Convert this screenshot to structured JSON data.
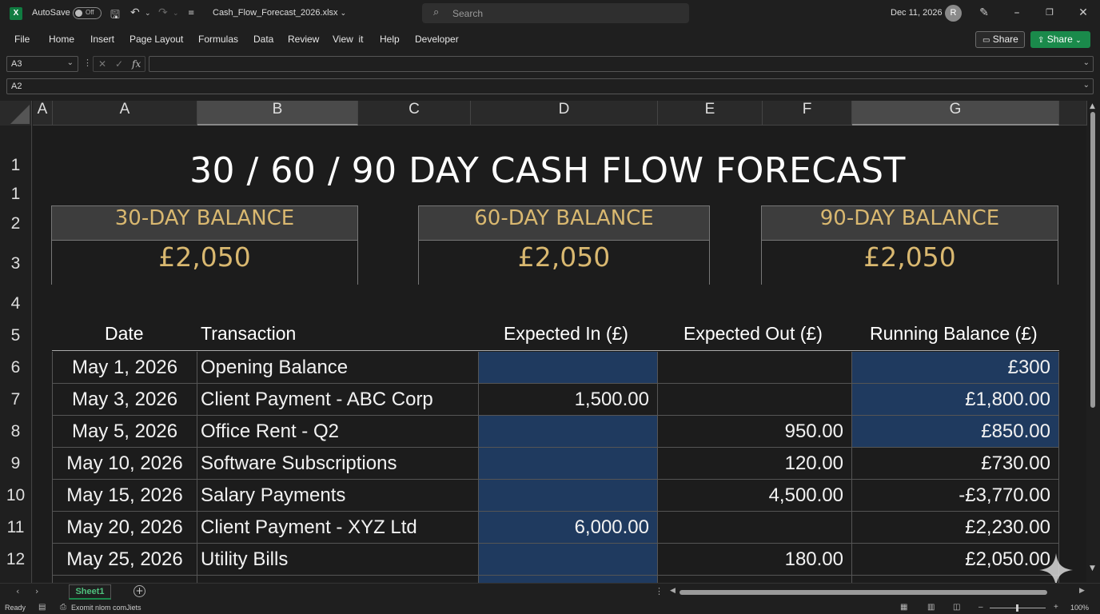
{
  "titlebar": {
    "app_icon": "excel-logo",
    "app_letter": "X",
    "autosave_label": "AutoSave",
    "autosave_state": "Off",
    "filename": "Cash_Flow_Forecast_2026.xlsx",
    "search_placeholder": "Search",
    "date": "Dec 11, 2026",
    "avatar_initial": "R"
  },
  "menu": {
    "items": [
      "File",
      "Home",
      "Insert",
      "Page Layout",
      "Formulas",
      "Data",
      "Review",
      "View  it",
      "Help",
      "Developer"
    ],
    "share_label": "Share",
    "share_green_label": "Share"
  },
  "formula_bar": {
    "name_box": "A3",
    "fx_label": "fx",
    "formula": "",
    "secondary_name_box": "A2"
  },
  "grid": {
    "corner_col_label": "A",
    "columns": [
      "A",
      "B",
      "C",
      "D",
      "E",
      "F",
      "G"
    ],
    "selected_columns": [
      "B",
      "G"
    ],
    "rows": [
      "1",
      "1",
      "2",
      "3",
      "4",
      "5",
      "6",
      "7",
      "8",
      "9",
      "10",
      "11",
      "12"
    ]
  },
  "sheet": {
    "title": "30 / 60 / 90 DAY CASH FLOW FORECAST",
    "balances": [
      {
        "label": "30-DAY BALANCE",
        "value": "£2,050"
      },
      {
        "label": "60-DAY BALANCE",
        "value": "£2,050"
      },
      {
        "label": "90-DAY BALANCE",
        "value": "£2,050"
      }
    ],
    "table_headers": {
      "date": "Date",
      "transaction": "Transaction",
      "expected_in": "Expected In (£)",
      "expected_out": "Expected Out (£)",
      "running_balance": "Running Balance (£)"
    },
    "rows": [
      {
        "date": "May 1, 2026",
        "transaction": "Opening Balance",
        "in": "",
        "out": "",
        "balance": "£300"
      },
      {
        "date": "May 3, 2026",
        "transaction": "Client Payment - ABC Corp",
        "in": "1,500.00",
        "out": "",
        "balance": "£1,800.00"
      },
      {
        "date": "May 5, 2026",
        "transaction": "Office Rent - Q2",
        "in": "",
        "out": "950.00",
        "balance": "£850.00"
      },
      {
        "date": "May 10, 2026",
        "transaction": "Software Subscriptions",
        "in": "",
        "out": "120.00",
        "balance": "£730.00"
      },
      {
        "date": "May 15, 2026",
        "transaction": "Salary Payments",
        "in": "",
        "out": "4,500.00",
        "balance": "-£3,770.00"
      },
      {
        "date": "May 20, 2026",
        "transaction": "Client Payment - XYZ Ltd",
        "in": "6,000.00",
        "out": "",
        "balance": "£2,230.00"
      },
      {
        "date": "May 25, 2026",
        "transaction": "Utility Bills",
        "in": "",
        "out": "180.00",
        "balance": "£2,050.00"
      }
    ]
  },
  "tabs": {
    "sheet_name": "Sheet1",
    "add_label": "+"
  },
  "status": {
    "ready": "Ready",
    "accessibility": "Exomit nlom comJiets",
    "zoom": "100%"
  },
  "colors": {
    "accent_green": "#1a8a4b",
    "gold_text": "#d9b870",
    "blue_fill": "#1f3a5f",
    "background": "#1c1c1c"
  }
}
